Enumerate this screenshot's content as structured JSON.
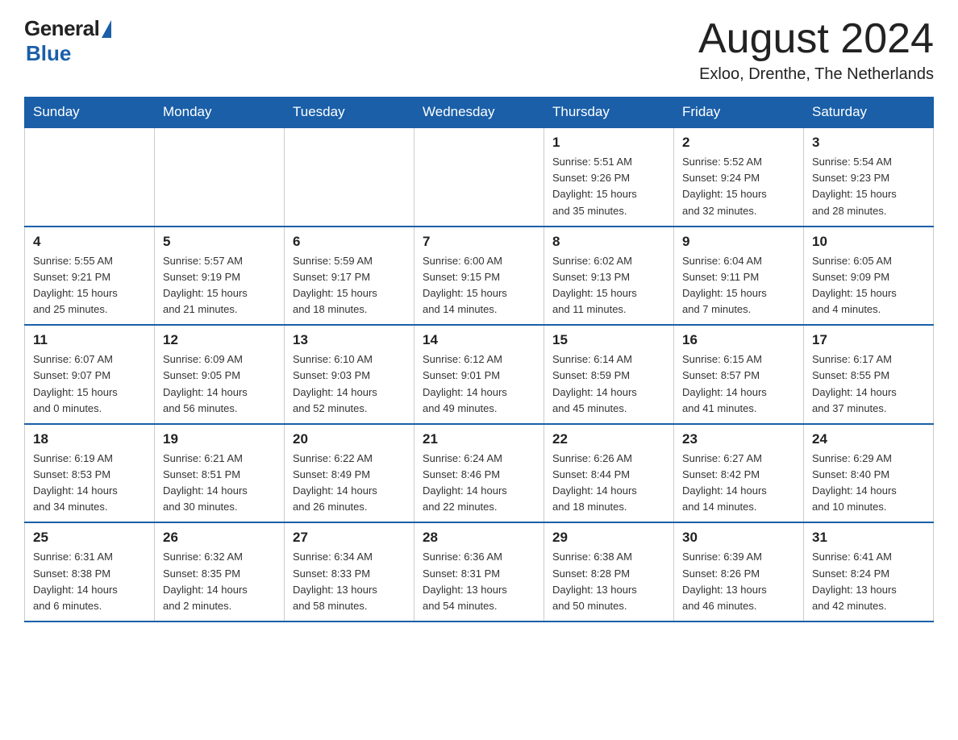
{
  "header": {
    "logo_general": "General",
    "logo_blue": "Blue",
    "month_title": "August 2024",
    "location": "Exloo, Drenthe, The Netherlands"
  },
  "calendar": {
    "days_of_week": [
      "Sunday",
      "Monday",
      "Tuesday",
      "Wednesday",
      "Thursday",
      "Friday",
      "Saturday"
    ],
    "weeks": [
      [
        {
          "day": "",
          "info": ""
        },
        {
          "day": "",
          "info": ""
        },
        {
          "day": "",
          "info": ""
        },
        {
          "day": "",
          "info": ""
        },
        {
          "day": "1",
          "info": "Sunrise: 5:51 AM\nSunset: 9:26 PM\nDaylight: 15 hours\nand 35 minutes."
        },
        {
          "day": "2",
          "info": "Sunrise: 5:52 AM\nSunset: 9:24 PM\nDaylight: 15 hours\nand 32 minutes."
        },
        {
          "day": "3",
          "info": "Sunrise: 5:54 AM\nSunset: 9:23 PM\nDaylight: 15 hours\nand 28 minutes."
        }
      ],
      [
        {
          "day": "4",
          "info": "Sunrise: 5:55 AM\nSunset: 9:21 PM\nDaylight: 15 hours\nand 25 minutes."
        },
        {
          "day": "5",
          "info": "Sunrise: 5:57 AM\nSunset: 9:19 PM\nDaylight: 15 hours\nand 21 minutes."
        },
        {
          "day": "6",
          "info": "Sunrise: 5:59 AM\nSunset: 9:17 PM\nDaylight: 15 hours\nand 18 minutes."
        },
        {
          "day": "7",
          "info": "Sunrise: 6:00 AM\nSunset: 9:15 PM\nDaylight: 15 hours\nand 14 minutes."
        },
        {
          "day": "8",
          "info": "Sunrise: 6:02 AM\nSunset: 9:13 PM\nDaylight: 15 hours\nand 11 minutes."
        },
        {
          "day": "9",
          "info": "Sunrise: 6:04 AM\nSunset: 9:11 PM\nDaylight: 15 hours\nand 7 minutes."
        },
        {
          "day": "10",
          "info": "Sunrise: 6:05 AM\nSunset: 9:09 PM\nDaylight: 15 hours\nand 4 minutes."
        }
      ],
      [
        {
          "day": "11",
          "info": "Sunrise: 6:07 AM\nSunset: 9:07 PM\nDaylight: 15 hours\nand 0 minutes."
        },
        {
          "day": "12",
          "info": "Sunrise: 6:09 AM\nSunset: 9:05 PM\nDaylight: 14 hours\nand 56 minutes."
        },
        {
          "day": "13",
          "info": "Sunrise: 6:10 AM\nSunset: 9:03 PM\nDaylight: 14 hours\nand 52 minutes."
        },
        {
          "day": "14",
          "info": "Sunrise: 6:12 AM\nSunset: 9:01 PM\nDaylight: 14 hours\nand 49 minutes."
        },
        {
          "day": "15",
          "info": "Sunrise: 6:14 AM\nSunset: 8:59 PM\nDaylight: 14 hours\nand 45 minutes."
        },
        {
          "day": "16",
          "info": "Sunrise: 6:15 AM\nSunset: 8:57 PM\nDaylight: 14 hours\nand 41 minutes."
        },
        {
          "day": "17",
          "info": "Sunrise: 6:17 AM\nSunset: 8:55 PM\nDaylight: 14 hours\nand 37 minutes."
        }
      ],
      [
        {
          "day": "18",
          "info": "Sunrise: 6:19 AM\nSunset: 8:53 PM\nDaylight: 14 hours\nand 34 minutes."
        },
        {
          "day": "19",
          "info": "Sunrise: 6:21 AM\nSunset: 8:51 PM\nDaylight: 14 hours\nand 30 minutes."
        },
        {
          "day": "20",
          "info": "Sunrise: 6:22 AM\nSunset: 8:49 PM\nDaylight: 14 hours\nand 26 minutes."
        },
        {
          "day": "21",
          "info": "Sunrise: 6:24 AM\nSunset: 8:46 PM\nDaylight: 14 hours\nand 22 minutes."
        },
        {
          "day": "22",
          "info": "Sunrise: 6:26 AM\nSunset: 8:44 PM\nDaylight: 14 hours\nand 18 minutes."
        },
        {
          "day": "23",
          "info": "Sunrise: 6:27 AM\nSunset: 8:42 PM\nDaylight: 14 hours\nand 14 minutes."
        },
        {
          "day": "24",
          "info": "Sunrise: 6:29 AM\nSunset: 8:40 PM\nDaylight: 14 hours\nand 10 minutes."
        }
      ],
      [
        {
          "day": "25",
          "info": "Sunrise: 6:31 AM\nSunset: 8:38 PM\nDaylight: 14 hours\nand 6 minutes."
        },
        {
          "day": "26",
          "info": "Sunrise: 6:32 AM\nSunset: 8:35 PM\nDaylight: 14 hours\nand 2 minutes."
        },
        {
          "day": "27",
          "info": "Sunrise: 6:34 AM\nSunset: 8:33 PM\nDaylight: 13 hours\nand 58 minutes."
        },
        {
          "day": "28",
          "info": "Sunrise: 6:36 AM\nSunset: 8:31 PM\nDaylight: 13 hours\nand 54 minutes."
        },
        {
          "day": "29",
          "info": "Sunrise: 6:38 AM\nSunset: 8:28 PM\nDaylight: 13 hours\nand 50 minutes."
        },
        {
          "day": "30",
          "info": "Sunrise: 6:39 AM\nSunset: 8:26 PM\nDaylight: 13 hours\nand 46 minutes."
        },
        {
          "day": "31",
          "info": "Sunrise: 6:41 AM\nSunset: 8:24 PM\nDaylight: 13 hours\nand 42 minutes."
        }
      ]
    ]
  }
}
